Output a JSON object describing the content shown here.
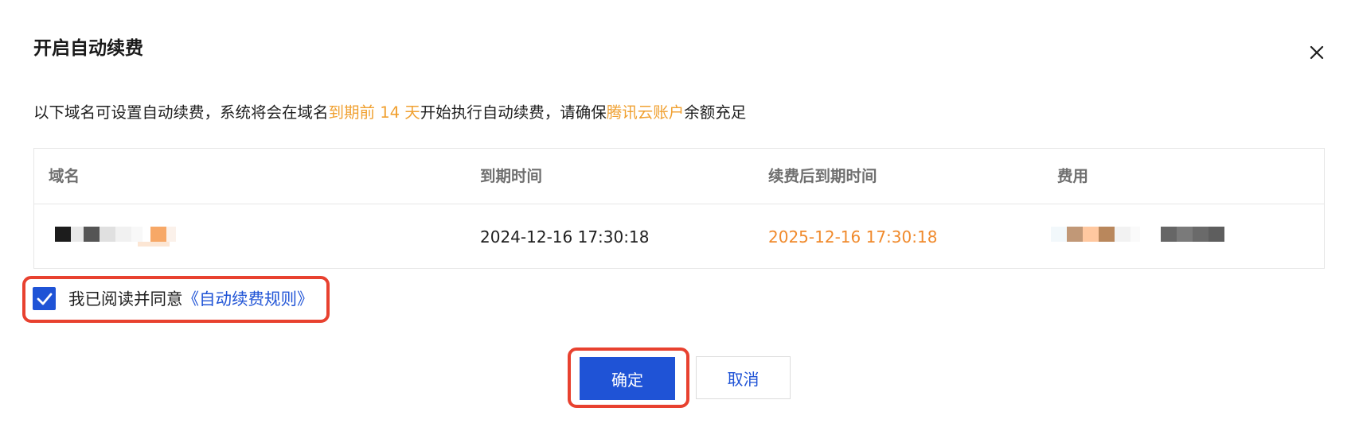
{
  "dialog": {
    "title": "开启自动续费",
    "close_icon": "close-icon"
  },
  "description": {
    "part1": "以下域名可设置自动续费，系统将会在域名",
    "highlight1": "到期前 14 天",
    "part2": "开始执行自动续费，请确保",
    "highlight2": "腾讯云账户",
    "part3": "余额充足",
    "highlight_color": "#f0a030"
  },
  "table": {
    "columns": [
      "域名",
      "到期时间",
      "续费后到期时间",
      "费用"
    ],
    "rows": [
      {
        "domain": "",
        "expire_time": "2024-12-16 17:30:18",
        "renewed_expire_time": "2025-12-16 17:30:18",
        "fee": ""
      }
    ]
  },
  "agreement": {
    "checked": true,
    "label": "我已阅读并同意",
    "link": "《自动续费规则》",
    "check_icon": "check-icon"
  },
  "buttons": {
    "confirm": "确定",
    "cancel": "取消"
  },
  "colors": {
    "primary": "#1f53d6",
    "orange": "#f08a2c",
    "annotation_red": "#e8412f"
  }
}
